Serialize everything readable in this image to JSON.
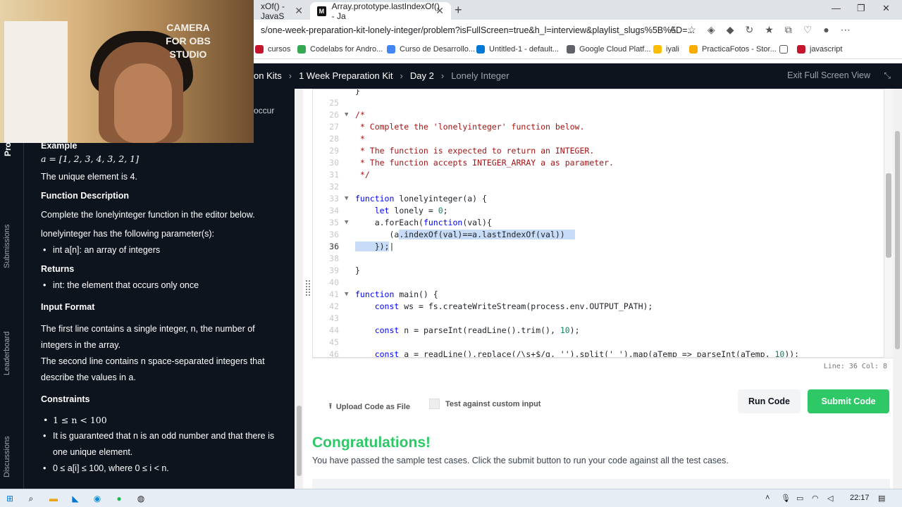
{
  "browser": {
    "tabs": [
      {
        "title": "xOf() - JavaS",
        "active": false
      },
      {
        "title": "Array.prototype.lastIndexOf() - Ja",
        "active": true
      }
    ],
    "url": "s/one-week-preparation-kit-lonely-integer/problem?isFullScreen=true&h_l=interview&playlist_slugs%5B%5D=...",
    "bookmarks": [
      "cursos",
      "Codelabs for Andro...",
      "Curso de Desarrollo...",
      "Untitled-1 - default...",
      "Google Cloud Platf...",
      "iyali",
      "PracticaFotos - Stor...",
      "javascript"
    ]
  },
  "webcam": {
    "label": "CAMERA FOR OBS STUDIO"
  },
  "header": {
    "crumbs": [
      "on Kits",
      "1 Week Preparation Kit",
      "Day 2",
      "Lonely Integer"
    ],
    "exit_label": "Exit Full Screen View"
  },
  "sidebar": {
    "tabs": [
      "Pro",
      "Submissions",
      "Leaderboard",
      "Discussions"
    ]
  },
  "problem": {
    "occur_fragment": "occur",
    "example_heading": "Example",
    "example_array": "a = [1, 2, 3, 4, 3, 2, 1]",
    "unique_text": "The unique element is 4.",
    "fd_heading": "Function Description",
    "fd_text": "Complete the lonelyinteger function in the editor below.",
    "params_text": "lonelyinteger has the following parameter(s):",
    "param1": "int a[n]: an array of integers",
    "returns_heading": "Returns",
    "returns1": "int: the element that occurs only once",
    "input_heading": "Input Format",
    "input_line1": "The first line contains a single integer, n, the number of integers in the array.",
    "input_line2": "The second line contains n space-separated integers that describe the values in a.",
    "constraints_heading": "Constraints",
    "c1": "1 ≤ n < 100",
    "c2": "It is guaranteed that n is an odd number and that there is one unique element.",
    "c3": "0 ≤ a[i] ≤ 100, where 0 ≤ i < n."
  },
  "editor": {
    "active_line_number": "36",
    "status": "Line: 36 Col: 8"
  },
  "actions": {
    "upload_label": "Upload Code as File",
    "custom_input_label": "Test against custom input",
    "run_label": "Run Code",
    "submit_label": "Submit Code"
  },
  "result": {
    "title": "Congratulations!",
    "message": "You have passed the sample test cases. Click the submit button to run your code against all the test cases."
  },
  "taskbar": {
    "time": "22:17"
  }
}
